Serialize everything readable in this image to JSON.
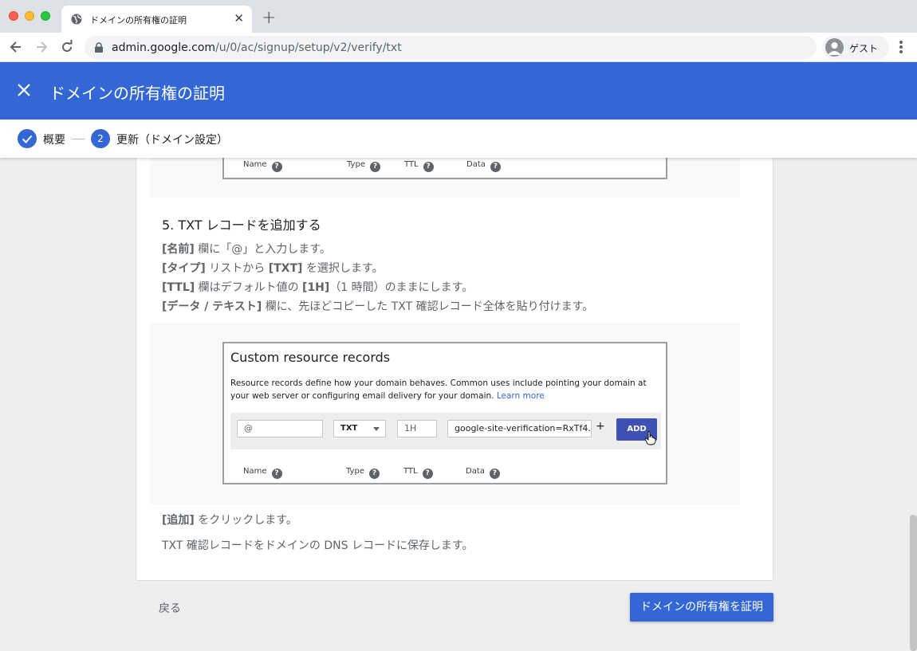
{
  "browser": {
    "tab_title": "ドメインの所有権の証明",
    "url_host": "admin.google.com",
    "url_path": "/u/0/ac/signup/setup/v2/verify/txt",
    "profile_label": "ゲスト"
  },
  "header": {
    "title": "ドメインの所有権の証明"
  },
  "stepper": {
    "step1_label": "概要",
    "step2_number": "2",
    "step2_label": "更新（ドメイン設定）"
  },
  "top_image": {
    "col_name": "Name",
    "col_type": "Type",
    "col_ttl": "TTL",
    "col_data": "Data",
    "help_glyph": "?"
  },
  "step5": {
    "title": "5. TXT レコードを追加する",
    "line1_bold": "[名前]",
    "line1_rest": " 欄に「@」と入力します。",
    "line2_bold": "[タイプ]",
    "line2_mid": " リストから ",
    "line2_bold2": "[TXT]",
    "line2_rest": " を選択します。",
    "line3_bold": "[TTL]",
    "line3_mid": " 欄はデフォルト値の ",
    "line3_bold2": "[1H]",
    "line3_rest": "（1 時間）のままにします。",
    "line4_bold": "[データ / テキスト]",
    "line4_rest": " 欄に、先ほどコピーした TXT 確認レコード全体を貼り付けます。"
  },
  "crr": {
    "title": "Custom resource records",
    "desc": "Resource records define how your domain behaves. Common uses include pointing your domain at your web server or configuring email delivery for your domain.",
    "learn_more": "Learn more",
    "name_value": "@",
    "type_value": "TXT",
    "ttl_value": "1H",
    "data_value": "google-site-verification=RxTf4...",
    "plus": "+",
    "add_label": "ADD",
    "col_name": "Name",
    "col_type": "Type",
    "col_ttl": "TTL",
    "col_data": "Data",
    "help_glyph": "?"
  },
  "footer": {
    "click_bold": "[追加]",
    "click_rest": " をクリックします。",
    "save_note": "TXT 確認レコードをドメインの DNS レコードに保存します。",
    "back_label": "戻る",
    "verify_label": "ドメインの所有権を証明"
  },
  "colors": {
    "brand_blue": "#3367d6",
    "add_button": "#3f51b5"
  }
}
